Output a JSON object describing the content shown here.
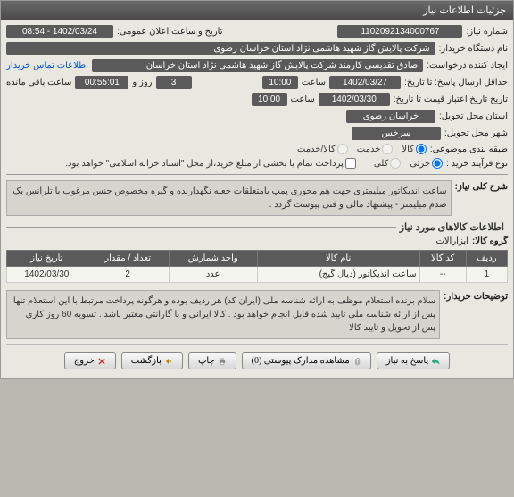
{
  "window_title": "جزئیات اطلاعات نیاز",
  "fields": {
    "need_number_label": "شماره نیاز:",
    "need_number": "1102092134000767",
    "announce_label": "تاریخ و ساعت اعلان عمومی:",
    "announce_value": "1402/03/24 - 08:54",
    "buyer_label": "نام دستگاه خریدار:",
    "buyer_value": "شرکت پالایش گاز شهید هاشمی نژاد   استان خراسان رضوی",
    "creator_label": "ایجاد کننده درخواست:",
    "creator_value": "صادق تقدیسی کارمند شرکت پالایش گاز شهید هاشمی نژاد   استان خراسان",
    "contact_link": "اطلاعات تماس خریدار",
    "deadline_label": "حداقل ارسال پاسخ: تا تاریخ:",
    "deadline_date": "1402/03/27",
    "deadline_time_label": "ساعت",
    "deadline_time": "10:00",
    "day_label": "روز و",
    "days": "3",
    "remain_label": "ساعت باقی مانده",
    "remain_time": "00:55:01",
    "validity_label": "تاریخ تاریخ اعتبار قیمت تا تاریخ:",
    "validity_date": "1402/03/30",
    "validity_time": "10:00",
    "need_province_label": "استان محل تحویل:",
    "need_province": "خراسان رضوی",
    "need_city_label": "شهر محل تحویل:",
    "need_city": "سرخس",
    "category_label": "طبقه بندی موضوعی:",
    "buy_type_label": "نوع فرآیند خرید :",
    "payment_note": "پرداخت تمام یا بخشی از مبلغ خرید،از محل \"اسناد خزانه اسلامی\" خواهد بود."
  },
  "categories": {
    "goods": "کالا",
    "service": "خدمت",
    "goods_service": "کالا/خدمت"
  },
  "buy_types": {
    "partial": "جزئی",
    "bulk": "کلی"
  },
  "sections": {
    "need_desc": "شرح کلی نیاز:",
    "items_info": "اطلاعات کالاهای مورد نیاز",
    "group_label": "گروه کالا:",
    "group_value": "ابزارآلات",
    "buyer_notes": "توضیحات خریدار:"
  },
  "need_description": "ساعت اندیکاتور میلیمتری جهت هم محوری پمپ بامتعلقات جعبه نگهدارنده و گیره مخصوص جنس مرغوب  با تلرانس یک صدم میلیمتر - پیشنهاد مالی و فنی پیوست گردد .",
  "table": {
    "headers": {
      "row": "ردیف",
      "code": "کد کالا",
      "name": "نام کالا",
      "unit": "واحد شمارش",
      "qty": "تعداد / مقدار",
      "date": "تاریخ نیاز"
    },
    "rows": [
      {
        "row": "1",
        "code": "--",
        "name": "ساعت اندیکاتور (دیال گیج)",
        "unit": "عدد",
        "qty": "2",
        "date": "1402/03/30"
      }
    ]
  },
  "buyer_notes": "سلام  برنده استعلام موظف به ارائه شناسه ملی (ایران کد) هر ردیف بوده و هرگونه پرداخت مرتبط با این استعلام تنها پس از ارائه شناسه ملی تایید شده قابل انجام خواهد بود . کالا ایرانی و با گارانتی معتبر باشد . تسویه 60 روز کاری پس از تحویل و تایید کالا",
  "buttons": {
    "respond": "پاسخ به نیاز",
    "attachments": "مشاهده مدارک پیوستی (0)",
    "print": "چاپ",
    "back": "بازگشت",
    "exit": "خروج"
  }
}
